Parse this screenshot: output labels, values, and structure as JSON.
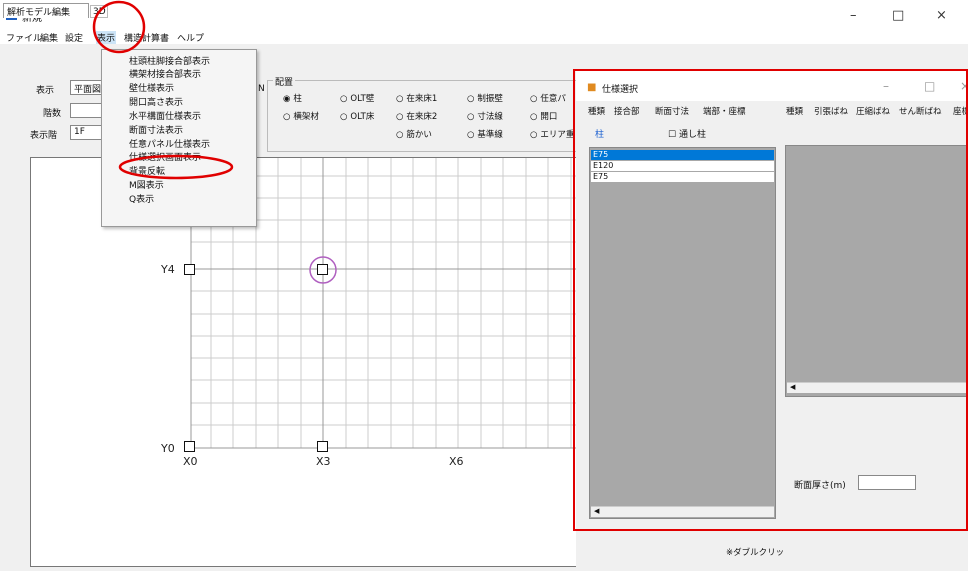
{
  "window": {
    "title": "新規",
    "minimize": "–",
    "maximize": "□",
    "close": "×"
  },
  "menu": [
    "ファイル",
    "編集",
    "設定",
    "表示",
    "構造計算書",
    "ヘルプ"
  ],
  "tabs": {
    "active": "解析モデル編集",
    "second": "3D"
  },
  "form": {
    "display_label": "表示",
    "display_value": "平面図",
    "floors_label": "階数",
    "floors_value": "",
    "floor_label": "表示階",
    "floor_value": "1F",
    "n_label": "N"
  },
  "placement": {
    "title": "配置",
    "options": [
      "柱",
      "OLT壁",
      "在来床1",
      "制振壁",
      "任意パ",
      "横架材",
      "OLT床",
      "在来床2",
      "寸法線",
      "開口",
      "筋かい",
      "基準線",
      "エリア重"
    ]
  },
  "view_menu": [
    "柱頭柱脚接合部表示",
    "横架材接合部表示",
    "壁仕様表示",
    "開口高さ表示",
    "水平構面仕様表示",
    "断面寸法表示",
    "任意パネル仕様表示",
    "仕様選択画面表示",
    "背景反転",
    "M図表示",
    "Q表示"
  ],
  "grid": {
    "y_labels": [
      "Y4",
      "Y0"
    ],
    "x_labels": [
      "X0",
      "X3",
      "X6"
    ]
  },
  "dialog": {
    "title": "仕様選択",
    "left_tabs": [
      "種類",
      "接合部",
      "断面寸法",
      "端部・座標"
    ],
    "right_tabs": [
      "種類",
      "引張ばね",
      "圧縮ばね",
      "せん断ばね",
      "座標"
    ],
    "kind": "柱",
    "through_column": "通し柱",
    "list_items": [
      "E75",
      "E120",
      "E75"
    ],
    "thickness_label": "断面厚さ(m)",
    "footer_note": "※ダブルクリッ"
  },
  "colors": {
    "highlight": "#e00000",
    "selection": "#0078d7",
    "node_circle": "#b060c0"
  }
}
